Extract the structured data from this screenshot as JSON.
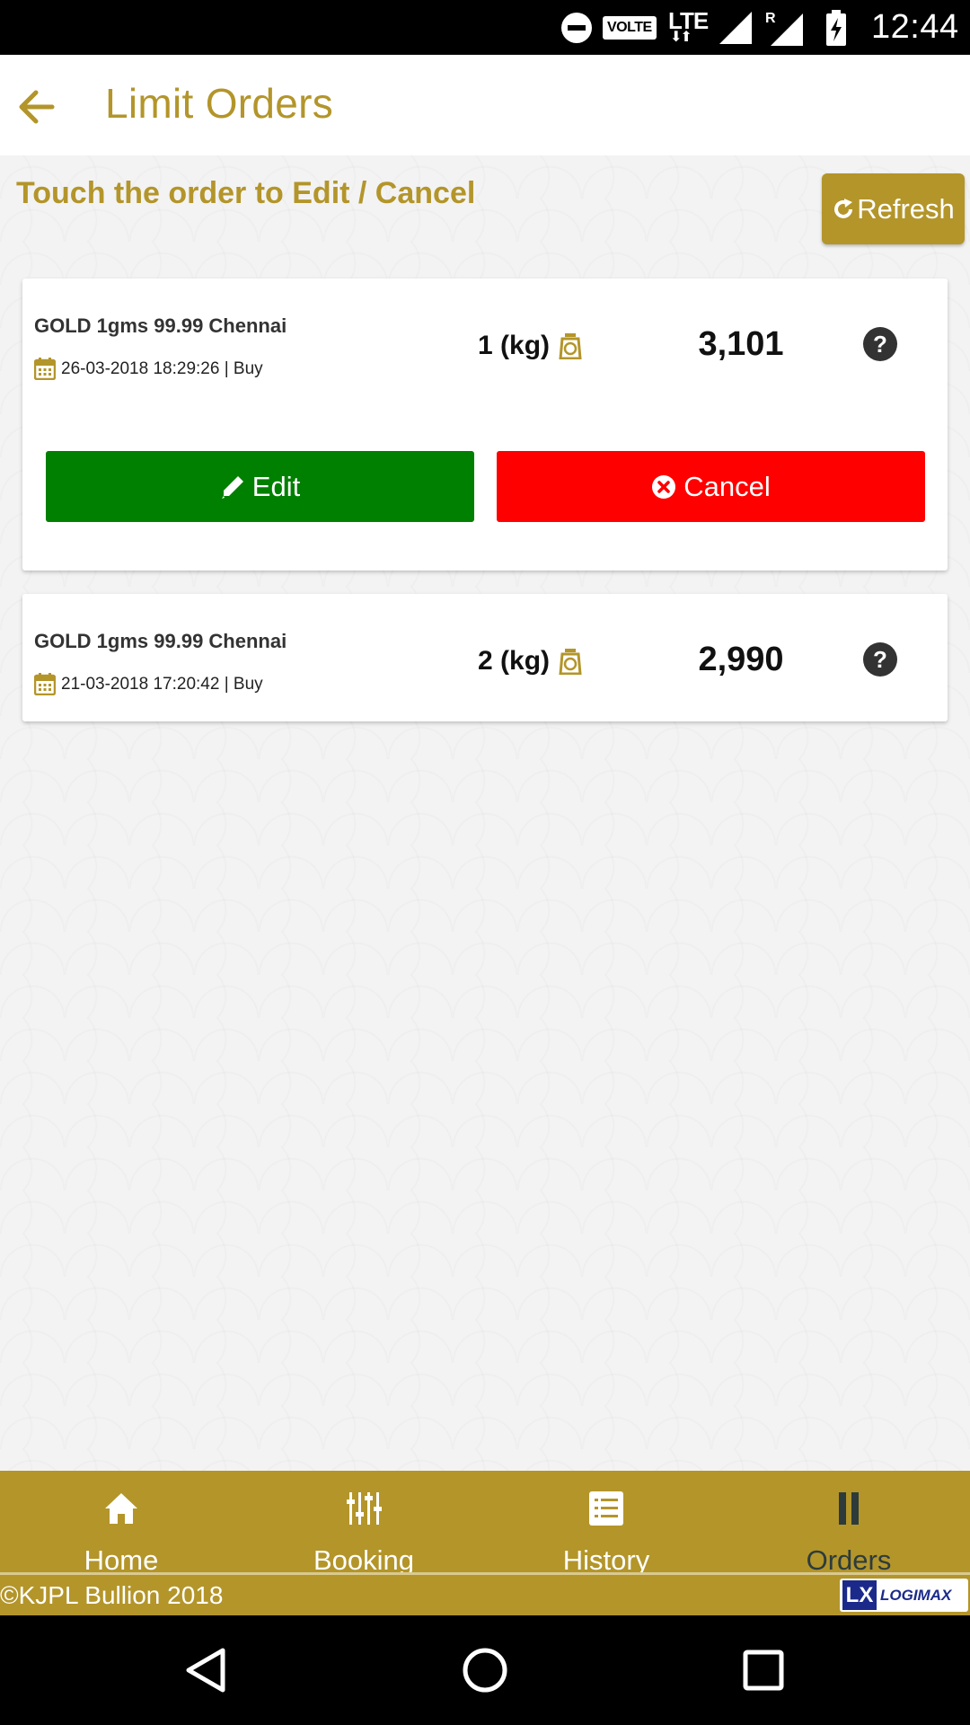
{
  "status_bar": {
    "volte": "VOLTE",
    "network": "LTE",
    "roaming": "R",
    "time": "12:44"
  },
  "header": {
    "title": "Limit Orders"
  },
  "hint": "Touch the order to Edit / Cancel",
  "refresh_label": "Refresh",
  "orders": [
    {
      "name": "GOLD 1gms 99.99 Chennai",
      "meta": "26-03-2018 18:29:26 | Buy",
      "qty": "1 (kg)",
      "price": "3,101",
      "help": "?",
      "edit_label": "Edit",
      "cancel_label": "Cancel"
    },
    {
      "name": "GOLD 1gms 99.99 Chennai",
      "meta": "21-03-2018 17:20:42 | Buy",
      "qty": "2 (kg)",
      "price": "2,990",
      "help": "?"
    }
  ],
  "nav": [
    {
      "label": "Home",
      "icon": "home-icon"
    },
    {
      "label": "Booking",
      "icon": "sliders-icon"
    },
    {
      "label": "History",
      "icon": "list-icon"
    },
    {
      "label": "Orders",
      "icon": "pause-icon",
      "active": true
    }
  ],
  "footer": {
    "copyright": "©KJPL Bullion 2018",
    "logo_mark": "LX",
    "logo_text": "LOGIMAX"
  },
  "colors": {
    "brand_gold": "#b3952a",
    "edit_green": "#008000",
    "cancel_red": "#ff0000",
    "active_nav": "#2d3b3b"
  }
}
